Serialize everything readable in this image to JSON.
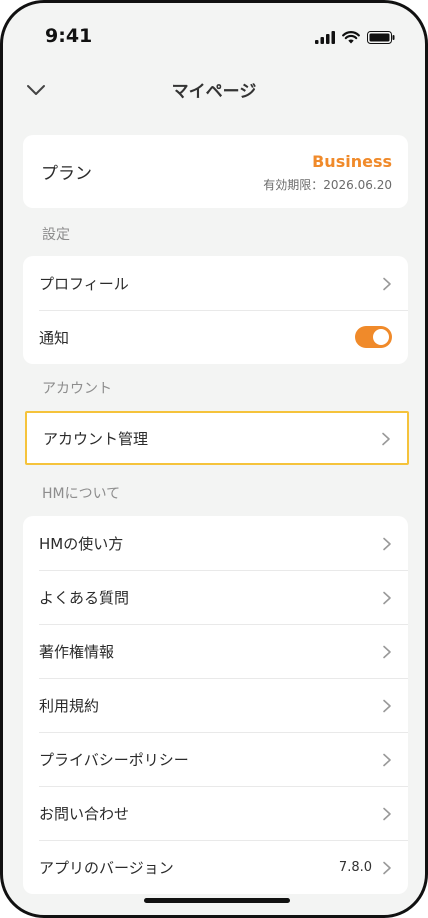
{
  "status_bar": {
    "time": "9:41"
  },
  "nav": {
    "title": "マイページ"
  },
  "plan": {
    "label": "プラン",
    "name": "Business",
    "expiry": "有効期限：2026.06.20"
  },
  "settings": {
    "section_label": "設定",
    "items": [
      {
        "label": "プロフィール"
      },
      {
        "label": "通知",
        "toggle_on": true
      }
    ]
  },
  "account": {
    "section_label": "アカウント",
    "items": [
      {
        "label": "アカウント管理"
      }
    ]
  },
  "about": {
    "section_label": "HMについて",
    "items": [
      {
        "label": "HMの使い方"
      },
      {
        "label": "よくある質問"
      },
      {
        "label": "著作権情報"
      },
      {
        "label": "利用規約"
      },
      {
        "label": "プライバシーポリシー"
      },
      {
        "label": "お問い合わせ"
      },
      {
        "label": "アプリのバージョン",
        "value": "7.8.0"
      }
    ]
  },
  "colors": {
    "accent": "#f08a2a",
    "highlight": "#f5c33b",
    "background": "#f3f4f3"
  }
}
